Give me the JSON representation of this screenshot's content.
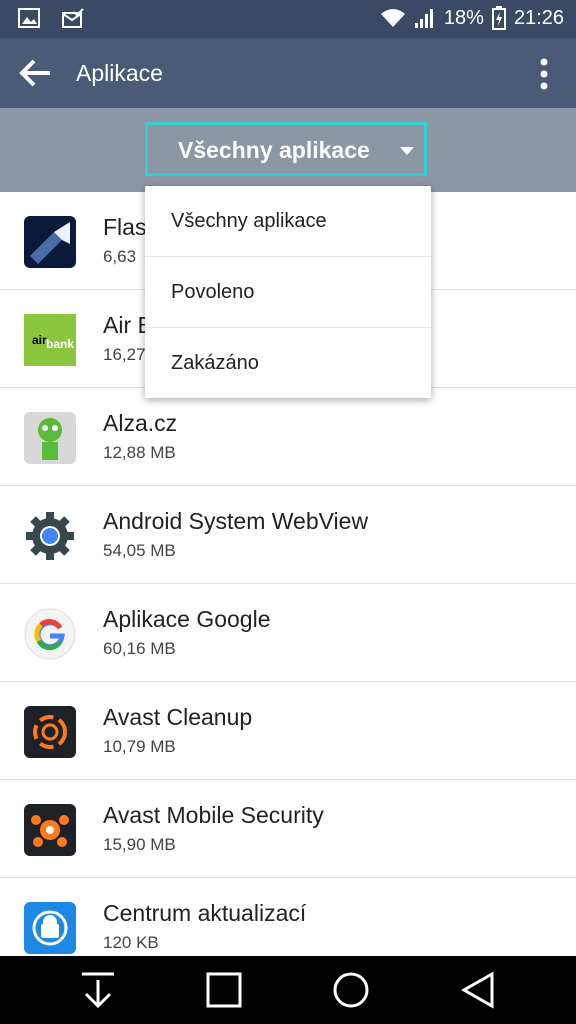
{
  "status": {
    "battery": "18%",
    "time": "21:26"
  },
  "header": {
    "title": "Aplikace"
  },
  "filter": {
    "selected": "Všechny aplikace"
  },
  "dropdown": {
    "options": [
      "Všechny aplikace",
      "Povoleno",
      "Zakázáno"
    ]
  },
  "apps": [
    {
      "name": "Flas",
      "size": "6,63",
      "icon": "flashlight-icon"
    },
    {
      "name": "Air B",
      "size": "16,27",
      "icon": "airbank-icon"
    },
    {
      "name": "Alza.cz",
      "size": "12,88 MB",
      "icon": "alza-icon"
    },
    {
      "name": "Android System WebView",
      "size": "54,05 MB",
      "icon": "webview-gear-icon"
    },
    {
      "name": "Aplikace Google",
      "size": "60,16 MB",
      "icon": "google-icon"
    },
    {
      "name": "Avast Cleanup",
      "size": "10,79 MB",
      "icon": "avast-cleanup-icon"
    },
    {
      "name": "Avast Mobile Security",
      "size": "15,90 MB",
      "icon": "avast-security-icon"
    },
    {
      "name": "Centrum aktualizací",
      "size": "120 KB",
      "icon": "update-center-icon"
    }
  ],
  "colors": {
    "statusbar": "#3a4a64",
    "appbar": "#4a5b78",
    "filterbar": "#8c96a4",
    "accent": "#30d0d0"
  }
}
